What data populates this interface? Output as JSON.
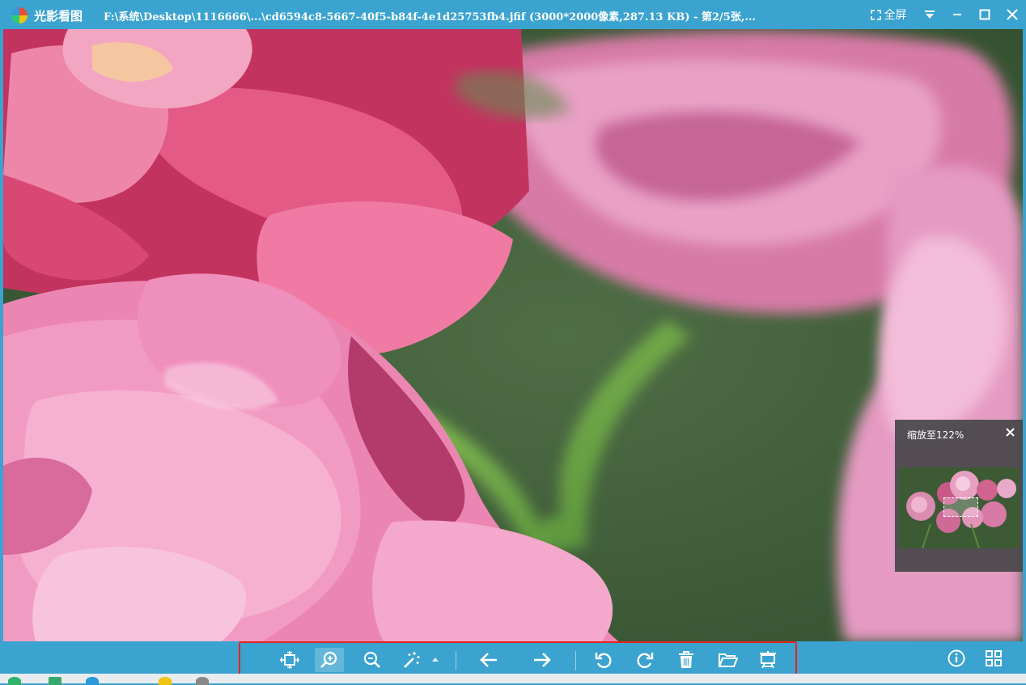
{
  "titlebar": {
    "app_name": "光影看图",
    "file_info": "F:\\系统\\Desktop\\1116666\\...\\cd6594c8-5667-40f5-b84f-4e1d25753fb4.jfif (3000*2000像素,287.13 KB) - 第2/5张,...",
    "fullscreen_label": "全屏"
  },
  "navigator": {
    "zoom_label": "缩放至122%"
  },
  "colors": {
    "accent": "#3aa3cf",
    "highlight_border": "#e8231f"
  },
  "toolbar": {
    "icons": [
      "fit-window-icon",
      "zoom-in-icon",
      "zoom-out-icon",
      "magic-wand-icon",
      "dropdown-arrow-icon",
      "previous-arrow-icon",
      "next-arrow-icon",
      "rotate-left-icon",
      "rotate-right-icon",
      "trash-icon",
      "open-folder-icon",
      "slideshow-icon"
    ],
    "right_icons": [
      "info-icon",
      "grid-icon"
    ]
  }
}
